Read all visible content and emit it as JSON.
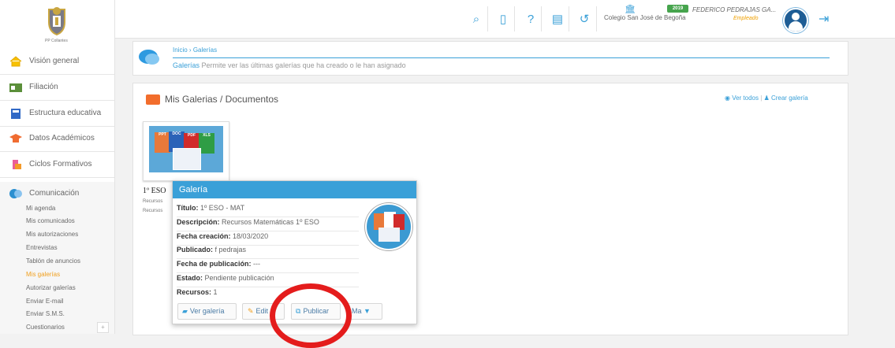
{
  "header": {
    "logo_text": "PP Collantes",
    "school": "Colegio San José de Begoña",
    "year_badge": "2019",
    "user_name": "FEDERICO PEDRAJAS GA...",
    "user_role": "Empleado",
    "icons": [
      "search-icon",
      "tablet-icon",
      "help-icon",
      "document-icon",
      "history-icon",
      "school-icon",
      "logout-icon"
    ]
  },
  "sidebar": {
    "items": [
      {
        "label": "Visión general",
        "icon": "home-icon"
      },
      {
        "label": "Filiación",
        "icon": "id-card-icon"
      },
      {
        "label": "Estructura educativa",
        "icon": "book-icon"
      },
      {
        "label": "Datos Académicos",
        "icon": "graduation-cap-icon"
      },
      {
        "label": "Ciclos Formativos",
        "icon": "cycle-icon"
      },
      {
        "label": "Comunicación",
        "icon": "chat-icon"
      }
    ],
    "sub_items": [
      "Mi agenda",
      "Mis comunicados",
      "Mis autorizaciones",
      "Entrevistas",
      "Tablón de anuncios",
      "Mis galerías",
      "Autorizar galerías",
      "Enviar E-mail",
      "Enviar S.M.S.",
      "Cuestionarios"
    ],
    "plus": "+"
  },
  "breadcrumb": {
    "home": "Inicio",
    "separator": "›",
    "current": "Galerías",
    "title": "Galerías",
    "description": "Permite ver las últimas galerías que ha creado o le han asignado"
  },
  "main": {
    "title": "Mis Galerias / Documentos",
    "view_all": "Ver todos",
    "create": "Crear galería",
    "thumb_label": "1º ESO",
    "small_lines": [
      "Recursos",
      "Recursos"
    ],
    "doc_tags": [
      "PPT",
      "DOC",
      "PDF",
      "XLS"
    ]
  },
  "popup": {
    "title": "Galería",
    "fields": [
      {
        "label": "Título:",
        "value": "1º ESO - MAT"
      },
      {
        "label": "Descripción:",
        "value": "Recursos Matemáticas 1º ESO"
      },
      {
        "label": "Fecha creación:",
        "value": "18/03/2020"
      },
      {
        "label": "Publicado:",
        "value": "f pedrajas"
      },
      {
        "label": "Fecha de publicación:",
        "value": "---"
      },
      {
        "label": "Estado:",
        "value": "Pendiente publicación"
      },
      {
        "label": "Recursos:",
        "value": "1"
      }
    ],
    "buttons": {
      "view": "Ver galería",
      "edit": "Edit",
      "publish": "Publicar",
      "more": "Ma"
    }
  }
}
